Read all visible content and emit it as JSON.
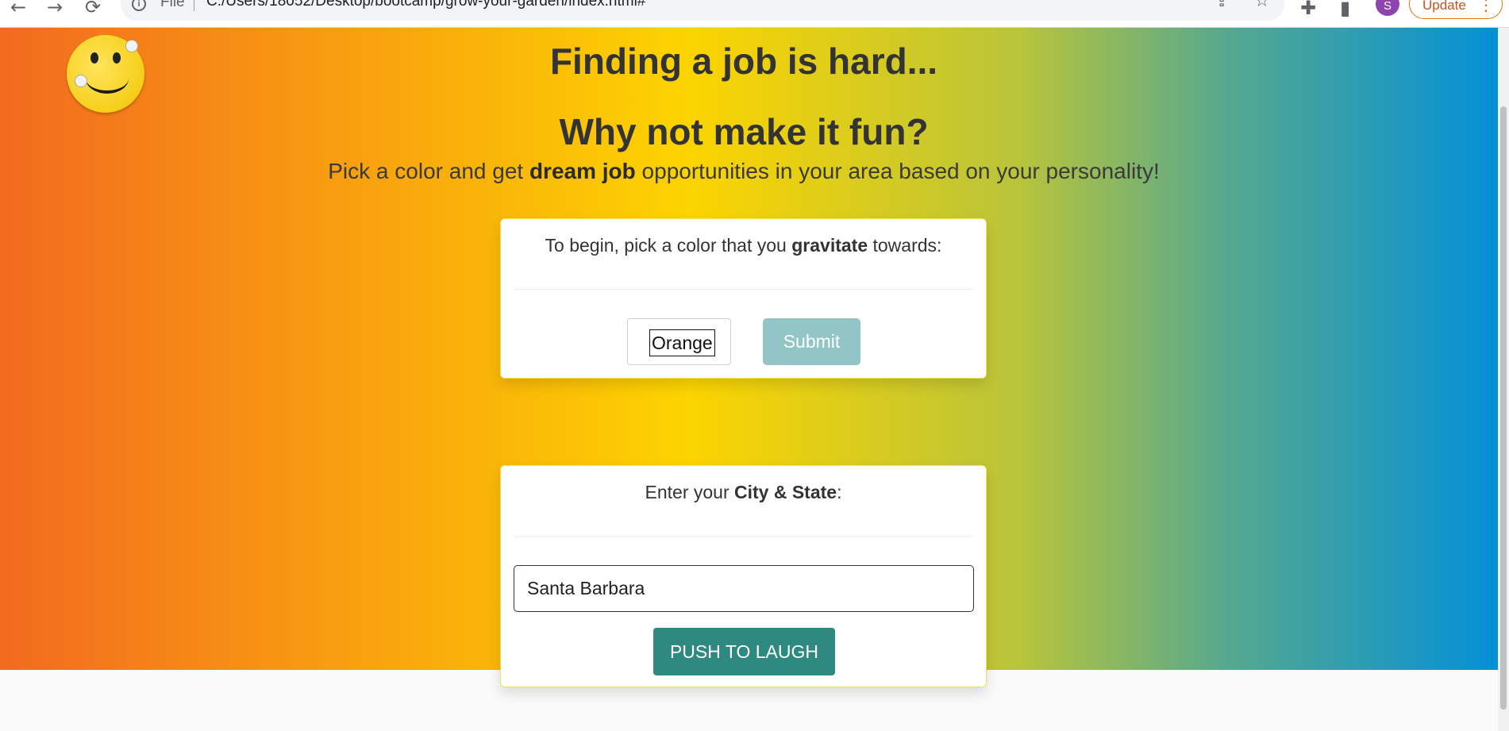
{
  "browser": {
    "back_icon": "←",
    "forward_icon": "→",
    "reload_icon": "⟳",
    "info_icon": "i",
    "scheme_label": "File",
    "url": "C:/Users/18052/Desktop/bootcamp/grow-your-garden/index.html#",
    "share_icon": "⇪",
    "star_icon": "☆",
    "extensions_icon": "✚",
    "sidepanel_icon": "▮",
    "profile_initial": "S",
    "update_label": "Update",
    "menu_icon": "⋮"
  },
  "hero": {
    "heading_1": "Finding a job is hard...",
    "heading_2": "Why not make it fun?",
    "subtitle_pre": "Pick a color and get ",
    "subtitle_bold": "dream job",
    "subtitle_post": " opportunities in your area based on your personality!"
  },
  "color_card": {
    "prompt_pre": "To begin, pick a color that you ",
    "prompt_bold": "gravitate",
    "prompt_post": " towards:",
    "color_value": "Orange",
    "submit_label": "Submit"
  },
  "city_card": {
    "prompt_pre": "Enter your ",
    "prompt_bold": "City & State",
    "prompt_post": ":",
    "city_value": "Santa Barbara",
    "button_label": "PUSH TO LAUGH"
  },
  "colors": {
    "gradient": [
      "#f26a1f",
      "#f9a30e",
      "#fcd400",
      "#b9c43a",
      "#55a88f",
      "#0390d7"
    ],
    "submit_button": "#92c5c6",
    "laugh_button": "#2e8a80",
    "card_border": "#f3e05a"
  }
}
